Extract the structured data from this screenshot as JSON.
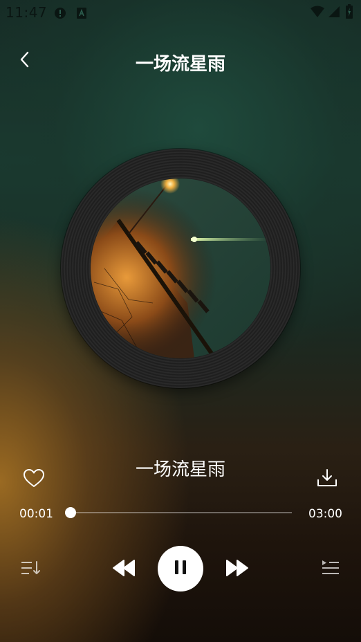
{
  "status_bar": {
    "time": "11:47",
    "icons": [
      "alert-icon",
      "notification-a-icon",
      "wifi-icon",
      "signal-icon",
      "battery-icon"
    ]
  },
  "header": {
    "title": "一场流星雨",
    "back_icon": "chevron-left-icon"
  },
  "player": {
    "song_title": "一场流星雨",
    "current_time": "00:01",
    "total_time": "03:00",
    "progress": 0.0056,
    "state": "playing"
  },
  "controls": {
    "like_icon": "heart-outline-icon",
    "download_icon": "download-icon",
    "playlist_mode_icon": "playlist-sort-icon",
    "previous_icon": "rewind-icon",
    "pause_icon": "pause-icon",
    "next_icon": "fast-forward-icon",
    "queue_icon": "playlist-queue-icon"
  },
  "colors": {
    "accent": "#ffffff",
    "disc": "#222222",
    "background_top": "#162b25",
    "background_bottom": "#140d08"
  }
}
